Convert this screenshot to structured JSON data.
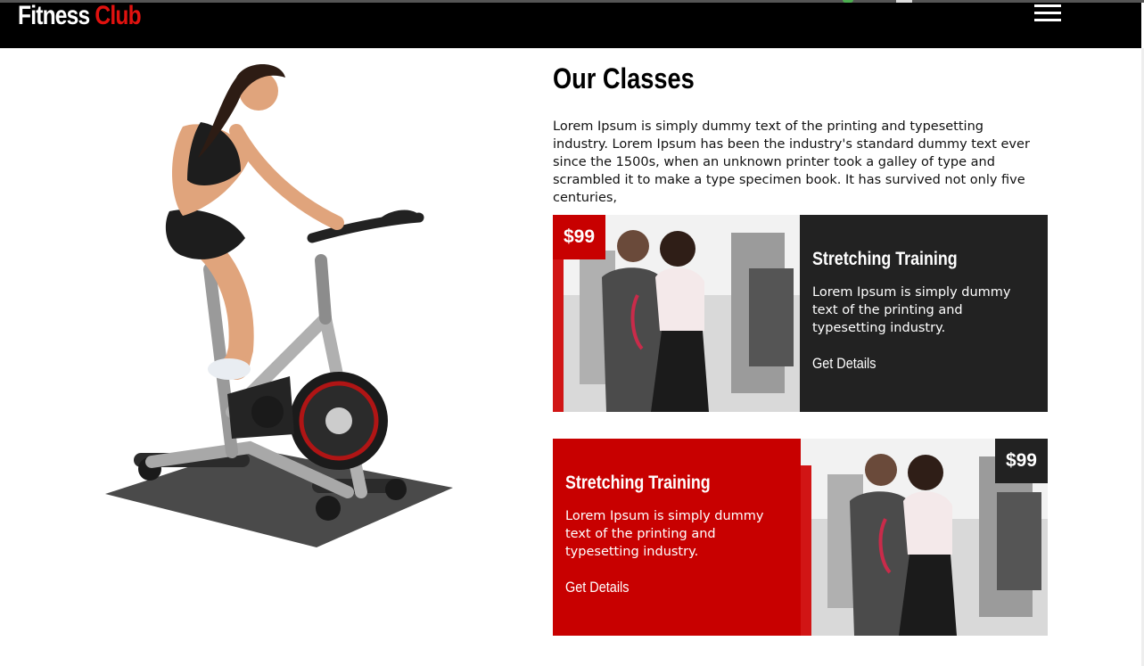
{
  "brand": {
    "name_part1": "Fitness",
    "name_part2": "Club",
    "accent_color": "#e0120f"
  },
  "nav": {
    "menu_icon": "hamburger-menu-icon"
  },
  "hero": {
    "image": "woman-on-exercise-bike-photo"
  },
  "section": {
    "title": "Our Classes",
    "intro": "Lorem Ipsum is simply dummy text of the printing and typesetting industry. Lorem Ipsum has been the industry's standard dummy text ever since the 1500s, when an unknown printer took a galley of type and scrambled it to make a type specimen book. It has survived not only five centuries,"
  },
  "classes": [
    {
      "price": "$99",
      "title": "Stretching Training",
      "description": "Lorem Ipsum is simply dummy text of the printing and typesetting industry.",
      "link": "Get Details",
      "panel_color": "#222222",
      "badge_color": "#c80000",
      "image": "trainer-with-client-gym-photo"
    },
    {
      "price": "$99",
      "title": "Stretching Training",
      "description": "Lorem Ipsum is simply dummy text of the printing and typesetting industry.",
      "link": "Get Details",
      "panel_color": "#c80000",
      "badge_color": "#222222",
      "image": "trainer-with-client-gym-photo"
    }
  ]
}
